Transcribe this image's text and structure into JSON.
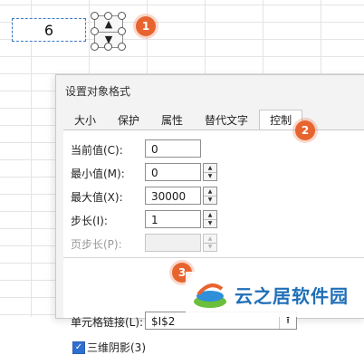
{
  "sheet": {
    "cell_value": "6"
  },
  "badges": [
    "1",
    "2",
    "3"
  ],
  "dialog": {
    "title": "设置对象格式",
    "tabs": [
      {
        "label": "大小",
        "active": false
      },
      {
        "label": "保护",
        "active": false
      },
      {
        "label": "属性",
        "active": false
      },
      {
        "label": "替代文字",
        "active": false
      },
      {
        "label": "控制",
        "active": true
      }
    ],
    "fields": {
      "current": {
        "label": "当前值(C):",
        "value": "0"
      },
      "min": {
        "label": "最小值(M):",
        "value": "0"
      },
      "max": {
        "label": "最大值(X):",
        "value": "30000"
      },
      "step": {
        "label": "步长(I):",
        "value": "1"
      },
      "page_step": {
        "label": "页步长(P):",
        "value": ""
      },
      "cell_link": {
        "label": "单元格链接(L):",
        "value": "$I$2"
      }
    },
    "checkbox_3d": {
      "label": "三维阴影(3)",
      "checked": true
    }
  },
  "watermark": {
    "text": "云之居软件园"
  },
  "colors": {
    "badge": "#e8642f",
    "checkbox": "#2f6fd1",
    "watermark_text": "#1f6fb8"
  }
}
